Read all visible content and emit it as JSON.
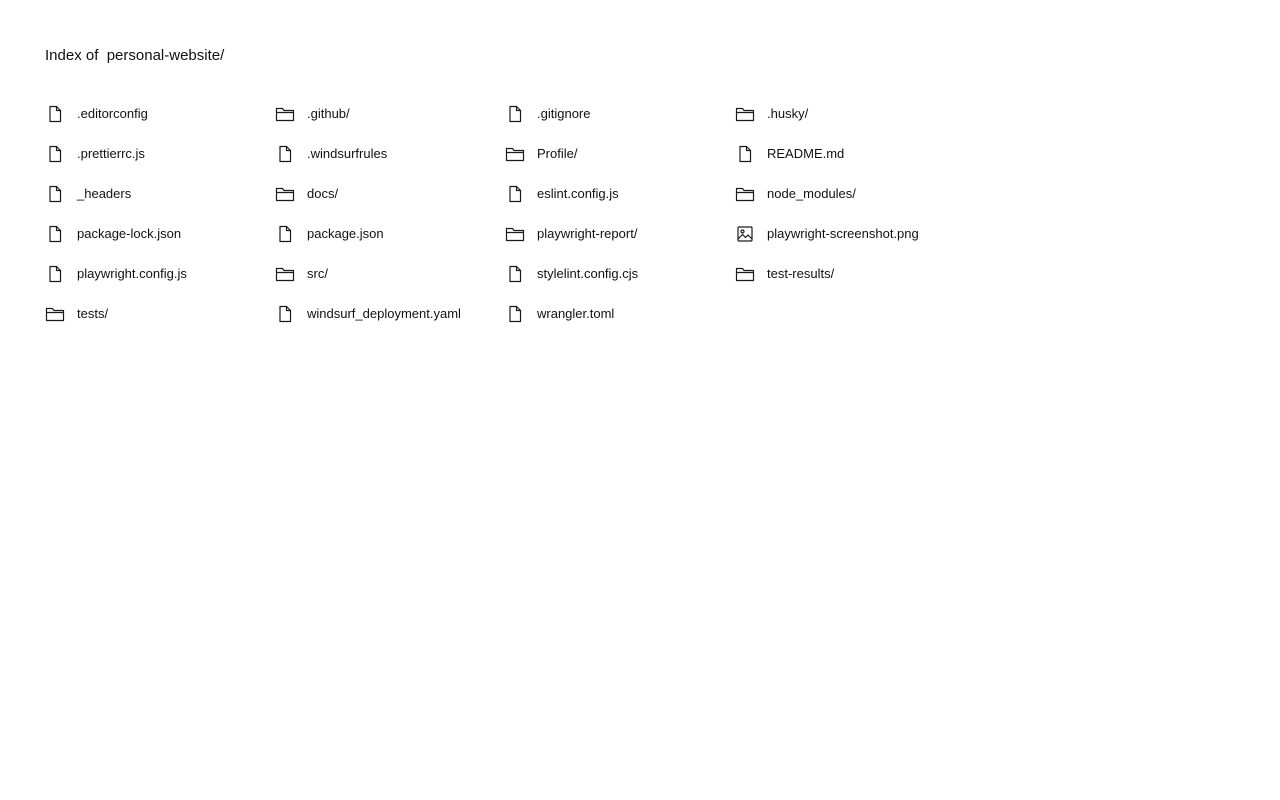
{
  "title_prefix": "Index of",
  "directory": "personal-website/",
  "entries": [
    {
      "name": ".editorconfig",
      "icon": "file-icon"
    },
    {
      "name": ".github/",
      "icon": "folder-icon"
    },
    {
      "name": ".gitignore",
      "icon": "file-icon"
    },
    {
      "name": ".husky/",
      "icon": "folder-icon"
    },
    {
      "name": ".prettierrc.js",
      "icon": "file-icon"
    },
    {
      "name": ".windsurfrules",
      "icon": "file-icon"
    },
    {
      "name": "Profile/",
      "icon": "folder-icon"
    },
    {
      "name": "README.md",
      "icon": "file-icon"
    },
    {
      "name": "_headers",
      "icon": "file-icon"
    },
    {
      "name": "docs/",
      "icon": "folder-icon"
    },
    {
      "name": "eslint.config.js",
      "icon": "file-icon"
    },
    {
      "name": "node_modules/",
      "icon": "folder-icon"
    },
    {
      "name": "package-lock.json",
      "icon": "file-icon"
    },
    {
      "name": "package.json",
      "icon": "file-icon"
    },
    {
      "name": "playwright-report/",
      "icon": "folder-icon"
    },
    {
      "name": "playwright-screenshot.png",
      "icon": "image-icon"
    },
    {
      "name": "playwright.config.js",
      "icon": "file-icon"
    },
    {
      "name": "src/",
      "icon": "folder-icon"
    },
    {
      "name": "stylelint.config.cjs",
      "icon": "file-icon"
    },
    {
      "name": "test-results/",
      "icon": "folder-icon"
    },
    {
      "name": "tests/",
      "icon": "folder-icon"
    },
    {
      "name": "windsurf_deployment.yaml",
      "icon": "file-icon"
    },
    {
      "name": "wrangler.toml",
      "icon": "file-icon"
    }
  ]
}
